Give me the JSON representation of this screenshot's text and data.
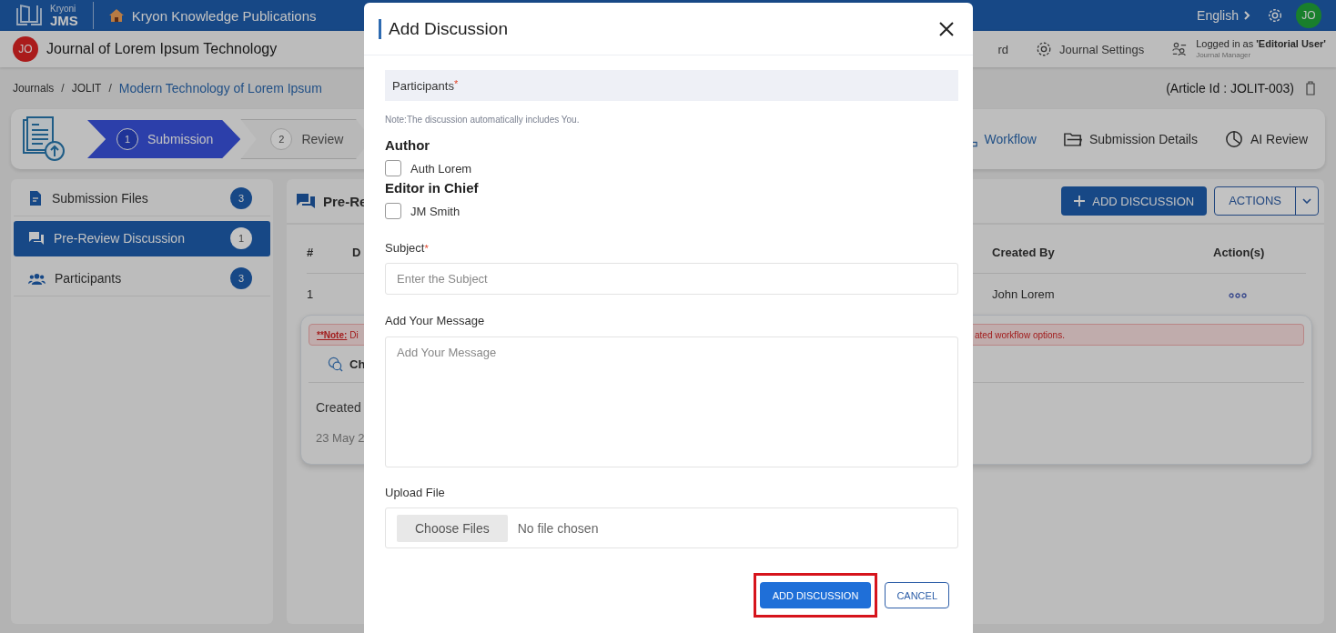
{
  "top_bar": {
    "logo_top": "Kryoni",
    "logo_bottom": "JMS",
    "publisher": "Kryon Knowledge Publications",
    "language": "English",
    "avatar": "JO"
  },
  "journal_bar": {
    "avatar": "JO",
    "title": "Journal of Lorem Ipsum Technology",
    "nav": [
      {
        "label": "rd",
        "kind": "plain"
      },
      {
        "label": "Journal Settings",
        "kind": "settings"
      }
    ],
    "user": {
      "line": "Logged in as **'Editorial User'**",
      "role": "Journal Manager"
    }
  },
  "breadcrumb": {
    "items": [
      {
        "label": "Journals",
        "selected": false
      },
      {
        "label": "JOLIT",
        "selected": false
      },
      {
        "label": "Modern Technology of Lorem Ipsum",
        "selected": true
      }
    ],
    "separators": [
      "/",
      "/"
    ]
  },
  "article_id": "(Article Id : JOLIT-003)",
  "workflow": {
    "steps": [
      {
        "number": "1",
        "label": "Submission",
        "selected": true
      },
      {
        "number": "2",
        "label": "Review",
        "selected": false
      }
    ],
    "views": [
      {
        "label": "Workflow",
        "kind": "workflow",
        "selected": true
      },
      {
        "label": "Submission Details",
        "kind": "folder",
        "selected": false
      },
      {
        "label": "AI Review",
        "kind": "pie",
        "selected": false
      }
    ]
  },
  "sidebar": {
    "items": [
      {
        "label": "Submission Files",
        "kind": "file",
        "count": "3",
        "selected": false
      },
      {
        "label": "Pre-Review Discussion",
        "kind": "chat",
        "count": "1",
        "selected": true
      },
      {
        "label": "Participants",
        "kind": "people",
        "count": "3",
        "selected": false
      }
    ]
  },
  "panel": {
    "title": "Pre-Re",
    "add_button": "ADD DISCUSSION",
    "actions_button": "ACTIONS",
    "table": {
      "columns": [
        {
          "label": "#"
        },
        {
          "label": "D"
        },
        {
          "label": "Created By"
        },
        {
          "label": "Action(s)"
        }
      ],
      "rows": [
        {
          "number": "1",
          "created_by": "John Lorem"
        }
      ]
    },
    "detail": {
      "note_label": "**Note:",
      "note_text": "Di",
      "note_end": "ated workflow options.",
      "chat_tab": "Ch",
      "created_label": "Created",
      "created_date": "23 May 2"
    }
  },
  "modal": {
    "title": "Add Discussion",
    "participants_label": "Participants",
    "required_mark": "*",
    "note": "Note:The discussion automatically includes You.",
    "groups": [
      {
        "role": "Author",
        "members": [
          {
            "name": "Auth Lorem",
            "checked": false
          }
        ]
      },
      {
        "role": "Editor in Chief",
        "members": [
          {
            "name": "JM Smith",
            "checked": false
          }
        ]
      }
    ],
    "subject": {
      "label": "Subject",
      "required_mark": "*",
      "placeholder": "Enter the Subject"
    },
    "message": {
      "label": "Add Your Message",
      "placeholder": "Add Your Message"
    },
    "upload": {
      "label": "Upload File",
      "button": "Choose Files",
      "status": "No file chosen"
    },
    "buttons": [
      {
        "label": "ADD DISCUSSION",
        "kind": "primary",
        "highlighted": true
      },
      {
        "label": "CANCEL",
        "kind": "secondary",
        "highlighted": false
      }
    ]
  }
}
